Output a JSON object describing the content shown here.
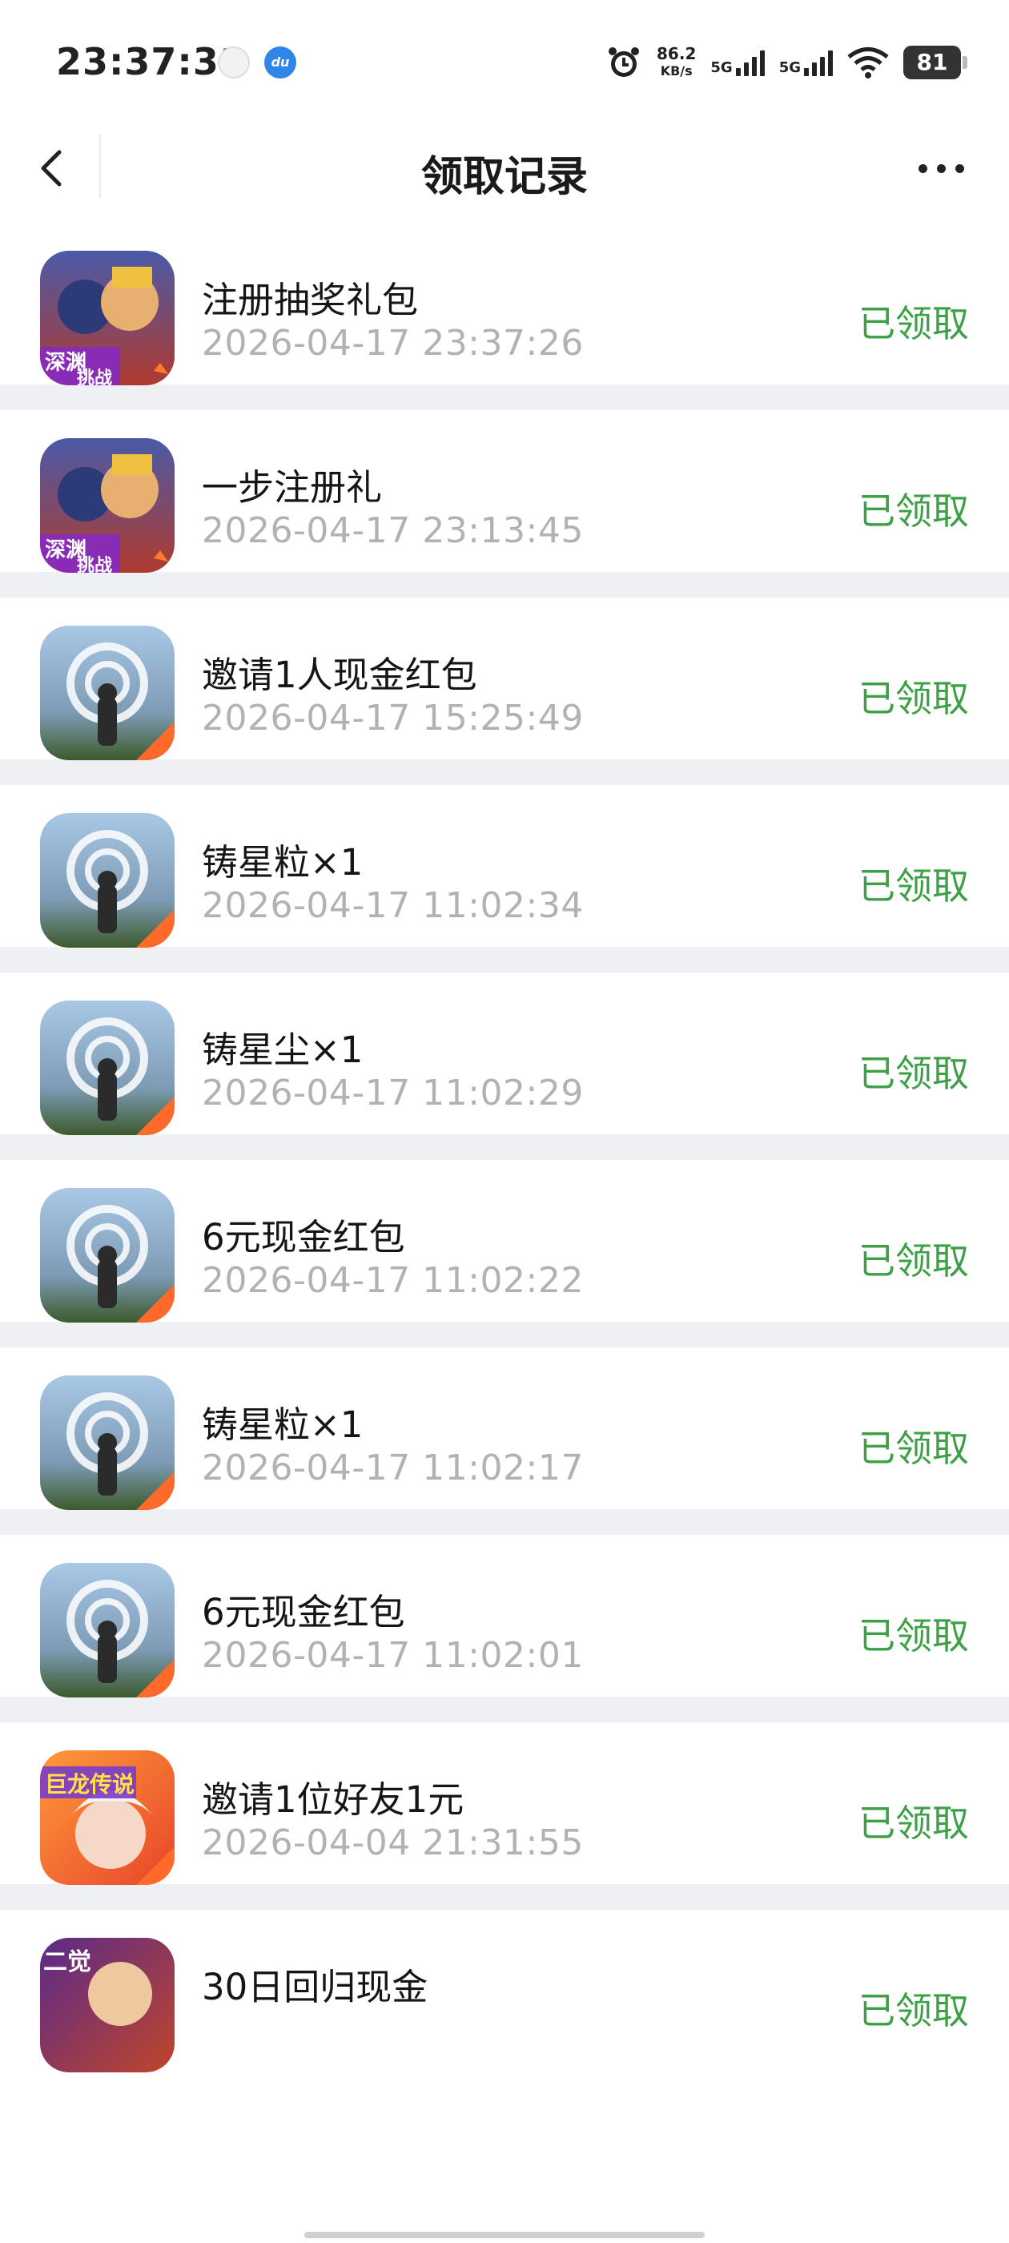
{
  "status_bar": {
    "time": "23:37:31",
    "mini_icon_b": "du",
    "net_speed_value": "86.2",
    "net_speed_unit": "KB/s",
    "sim1": "5G",
    "sim2": "5G",
    "battery": "81"
  },
  "nav": {
    "title": "领取记录"
  },
  "colors": {
    "status_green": "#3da046",
    "time_gray": "#b2b2b2",
    "separator": "#eef0f3"
  },
  "records": [
    {
      "icon": "game-icon-abyss-challenge",
      "title": "注册抽奖礼包",
      "time": "2026-04-17 23:37:26",
      "status": "已领取"
    },
    {
      "icon": "game-icon-abyss-challenge",
      "title": "一步注册礼",
      "time": "2026-04-17 23:13:45",
      "status": "已领取"
    },
    {
      "icon": "game-icon-wanderer",
      "title": "邀请1人现金红包",
      "time": "2026-04-17 15:25:49",
      "status": "已领取"
    },
    {
      "icon": "game-icon-wanderer",
      "title": "铸星粒×1",
      "time": "2026-04-17 11:02:34",
      "status": "已领取"
    },
    {
      "icon": "game-icon-wanderer",
      "title": "铸星尘×1",
      "time": "2026-04-17 11:02:29",
      "status": "已领取"
    },
    {
      "icon": "game-icon-wanderer",
      "title": "6元现金红包",
      "time": "2026-04-17 11:02:22",
      "status": "已领取"
    },
    {
      "icon": "game-icon-wanderer",
      "title": "铸星粒×1",
      "time": "2026-04-17 11:02:17",
      "status": "已领取"
    },
    {
      "icon": "game-icon-wanderer",
      "title": "6元现金红包",
      "time": "2026-04-17 11:02:01",
      "status": "已领取"
    },
    {
      "icon": "game-icon-legend",
      "title": "邀请1位好友1元",
      "time": "2026-04-04 21:31:55",
      "status": "已领取"
    },
    {
      "icon": "game-icon-second-awakening",
      "title": "30日回归现金",
      "time": "",
      "status": "已领取"
    }
  ]
}
